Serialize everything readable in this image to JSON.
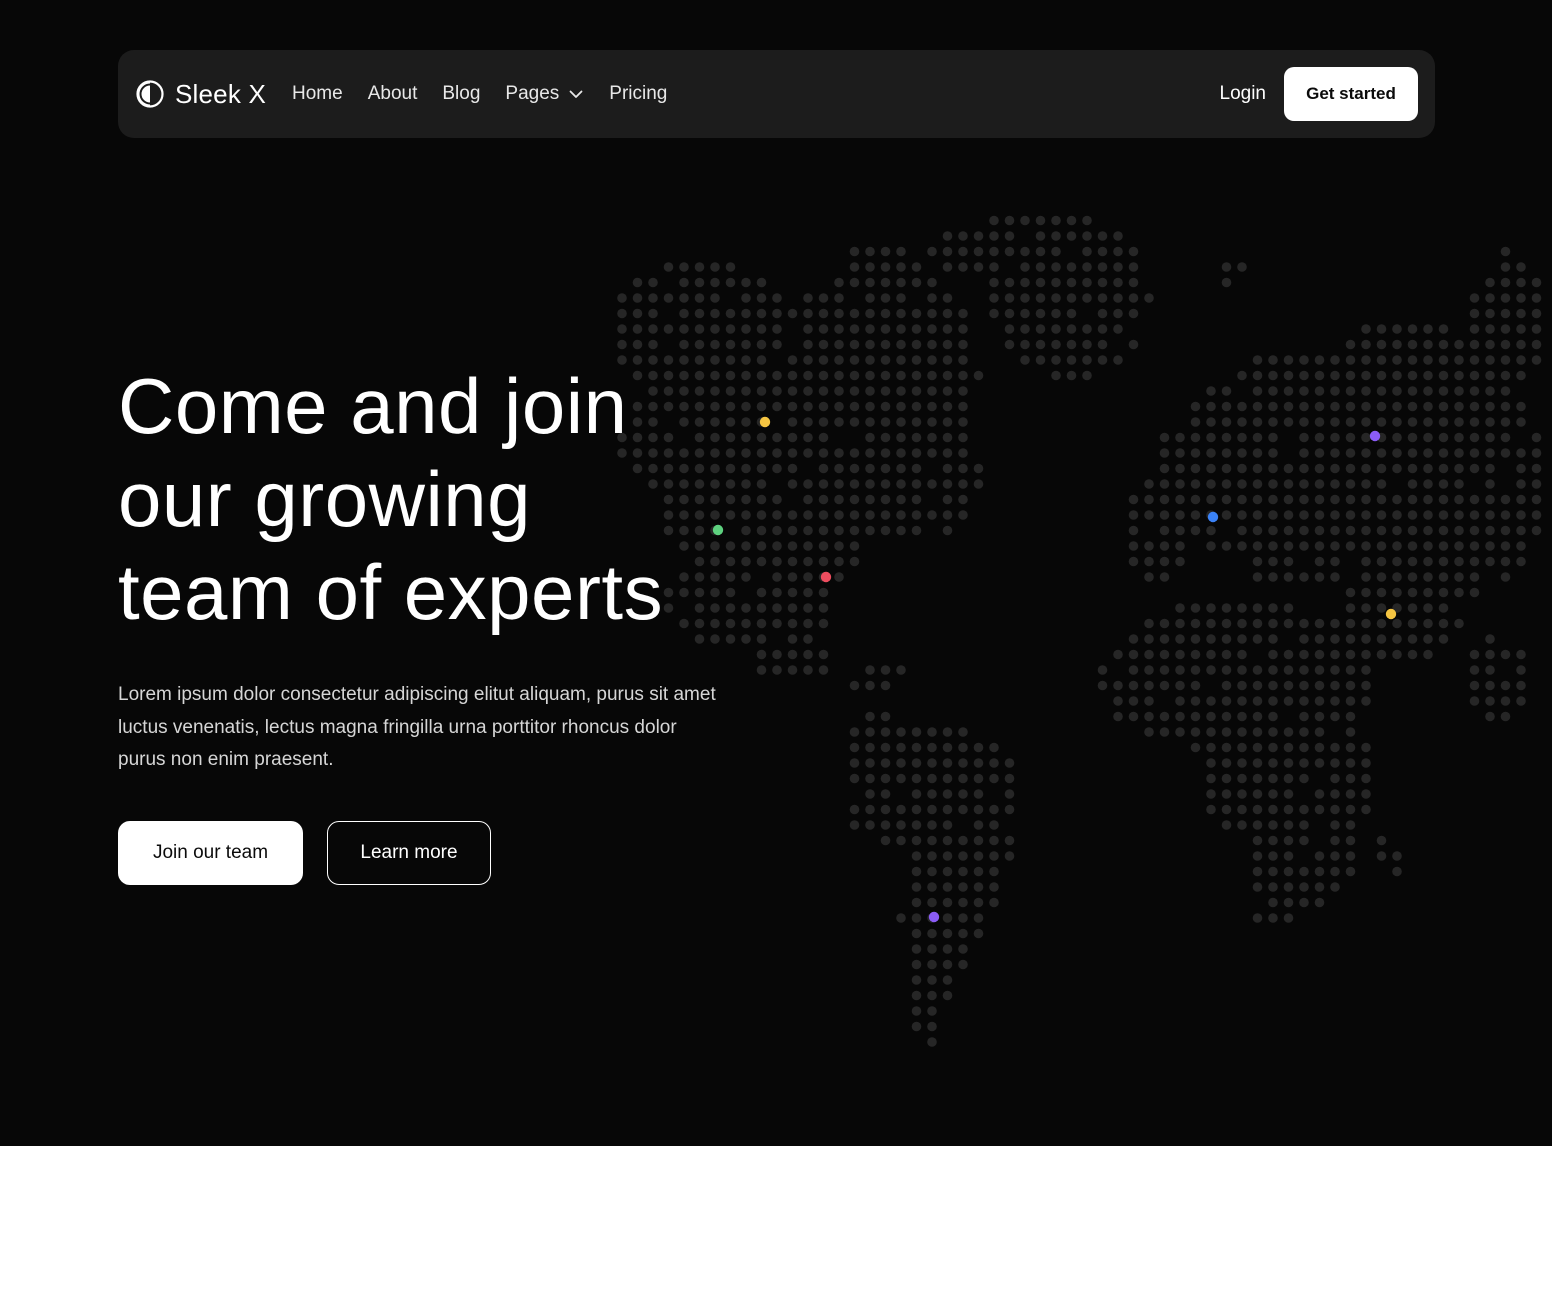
{
  "brand": {
    "name": "Sleek X",
    "logo_icon": "half-circle-logo-icon"
  },
  "nav": {
    "links": [
      {
        "label": "Home"
      },
      {
        "label": "About"
      },
      {
        "label": "Blog"
      },
      {
        "label": "Pages",
        "icon": "chevron-down-icon"
      },
      {
        "label": "Pricing"
      }
    ],
    "login_label": "Login",
    "cta_label": "Get started"
  },
  "hero": {
    "title_lines": [
      "Come and join",
      "our growing",
      "team of experts"
    ],
    "description": "Lorem ipsum dolor consectetur adipiscing elitut aliquam, purus sit amet luctus venenatis, lectus magna fringilla urna porttitor rhoncus dolor purus non enim praesent.",
    "primary_cta": "Join our team",
    "secondary_cta": "Learn more"
  },
  "colors": {
    "hero_background": "#070707",
    "navbar_background": "#1c1c1c",
    "map_dot": "#262626",
    "accent_yellow": "#f5c542",
    "accent_green": "#5ed17f",
    "accent_red": "#ee4d5f",
    "accent_blue": "#3b82f6",
    "accent_purple": "#8b5cf6"
  }
}
